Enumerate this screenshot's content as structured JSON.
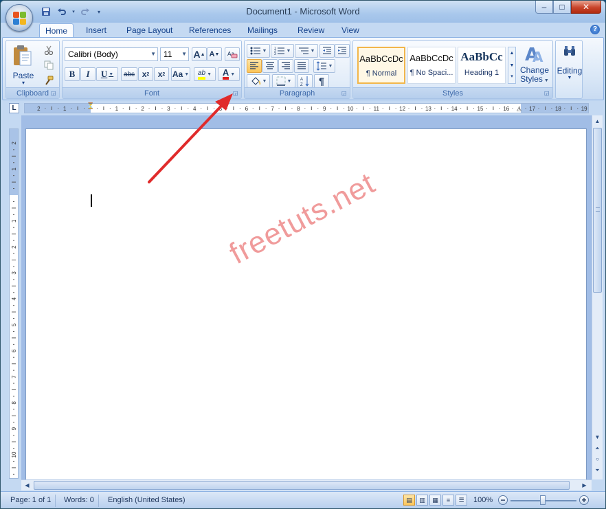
{
  "window": {
    "title": "Document1 - Microsoft Word",
    "controls": {
      "minimize": "–",
      "maximize": "□",
      "close": "✕"
    }
  },
  "quick_access": {
    "save_icon": "save-icon",
    "undo_icon": "undo-icon",
    "redo_icon": "redo-icon",
    "customize_icon": "chevron-down-icon"
  },
  "tabs": [
    {
      "label": "Home",
      "active": true
    },
    {
      "label": "Insert"
    },
    {
      "label": "Page Layout"
    },
    {
      "label": "References"
    },
    {
      "label": "Mailings"
    },
    {
      "label": "Review"
    },
    {
      "label": "View"
    }
  ],
  "help": "?",
  "ribbon": {
    "clipboard": {
      "label": "Clipboard",
      "paste_label": "Paste",
      "paste_arrow": "▾"
    },
    "font": {
      "label": "Font",
      "font_name": "Calibri (Body)",
      "font_size": "11",
      "grow": "A",
      "shrink": "A",
      "bold": "B",
      "italic": "I",
      "underline": "U",
      "strike": "abc",
      "subscript": "x",
      "subscript_mark": "2",
      "superscript": "x",
      "superscript_mark": "2",
      "change_case": "Aa",
      "highlight": "ab",
      "font_color": "A",
      "highlight_color": "#ffff00",
      "font_color_value": "#e02020"
    },
    "paragraph": {
      "label": "Paragraph",
      "show_marks": "¶"
    },
    "styles": {
      "label": "Styles",
      "tiles": [
        {
          "sample": "AaBbCcDc",
          "name": "¶ Normal",
          "selected": true
        },
        {
          "sample": "AaBbCcDc",
          "name": "¶ No Spaci..."
        },
        {
          "sample": "AaBbCc",
          "name": "Heading 1"
        }
      ],
      "change_styles_1": "Change",
      "change_styles_2": "Styles"
    },
    "editing": {
      "label": "Editing"
    }
  },
  "ruler": {
    "corner": "L",
    "h_numbers": [
      "2",
      "1",
      "1",
      "2",
      "3",
      "4",
      "5",
      "6",
      "7",
      "8",
      "9",
      "10",
      "11",
      "12",
      "13",
      "14",
      "15",
      "16",
      "17",
      "18",
      "19"
    ],
    "v_numbers": [
      "2",
      "1",
      "1",
      "2",
      "3",
      "4",
      "5",
      "6",
      "7",
      "8",
      "9",
      "10"
    ]
  },
  "document": {
    "watermark": "freetuts.net"
  },
  "status": {
    "page": "Page: 1 of 1",
    "words": "Words: 0",
    "language": "English (United States)",
    "zoom": "100%",
    "zoom_minus": "−",
    "zoom_plus": "+",
    "zoom_level": 100
  },
  "colors": {
    "annotation_arrow": "#e02b2b",
    "ribbon_accent": "#15428b"
  }
}
